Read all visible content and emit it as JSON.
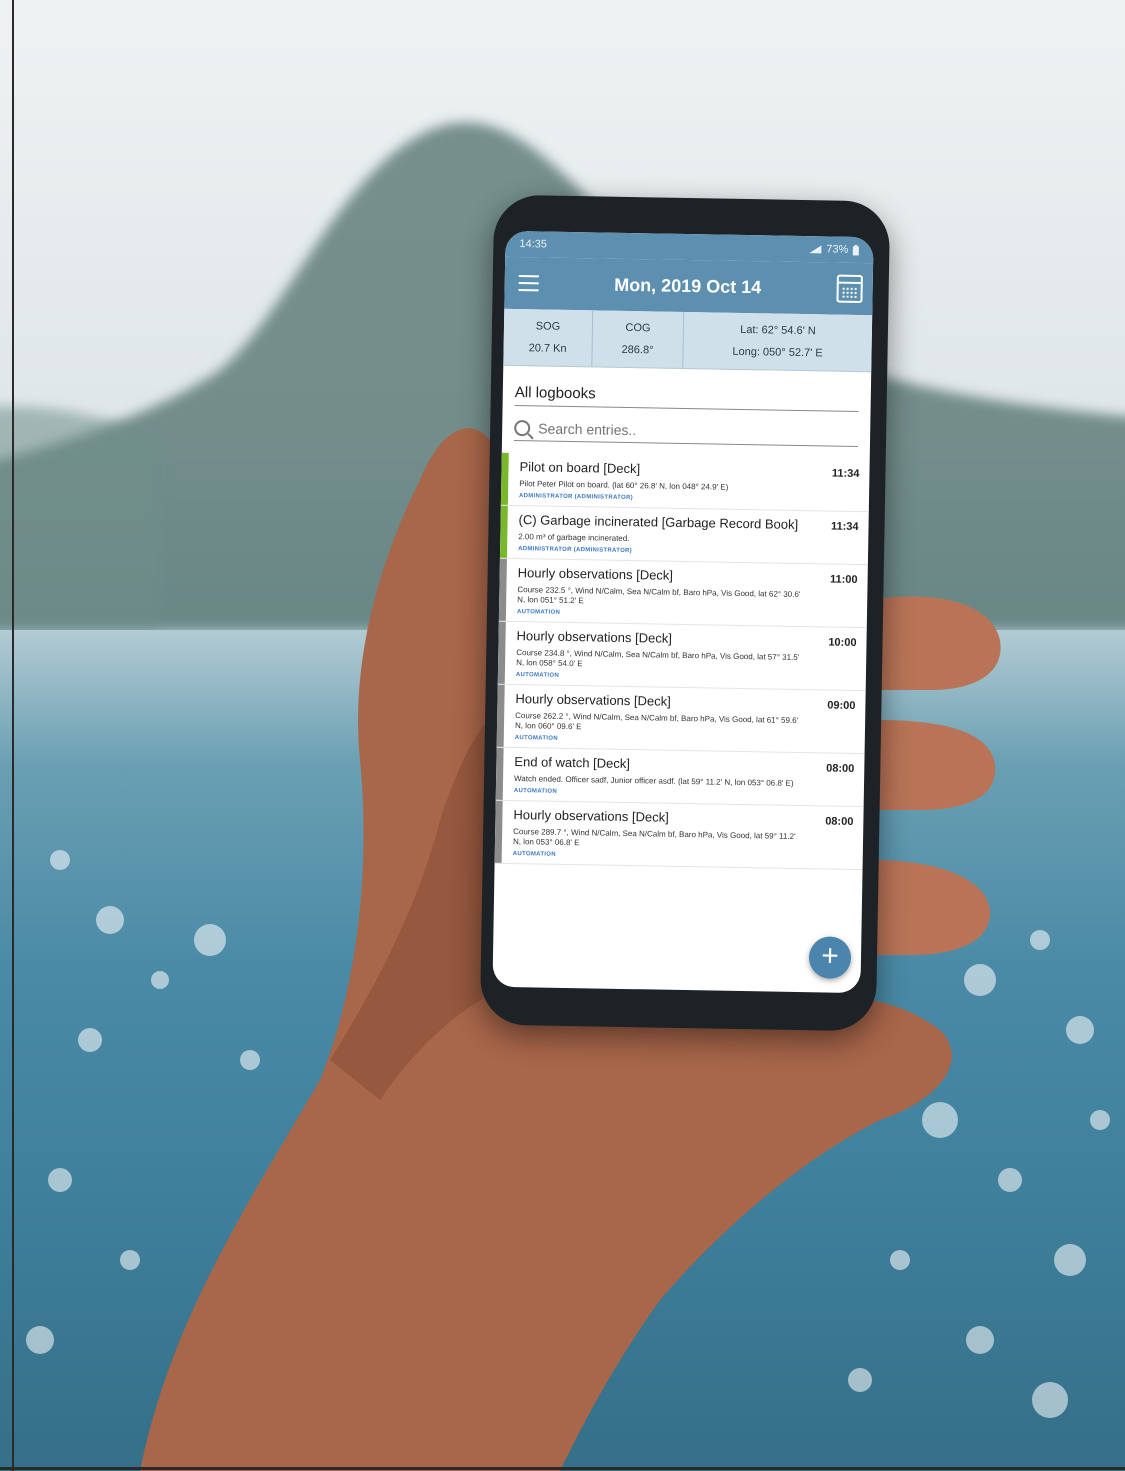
{
  "status_bar": {
    "time": "14:35",
    "battery": "73%"
  },
  "app_bar": {
    "title": "Mon, 2019 Oct 14"
  },
  "nav": {
    "sog_label": "SOG",
    "sog_value": "20.7 Kn",
    "cog_label": "COG",
    "cog_value": "286.8°",
    "lat": "Lat: 62° 54.6' N",
    "long": "Long: 050° 52.7' E"
  },
  "logbook_select": "All logbooks",
  "search": {
    "placeholder": "Search entries.."
  },
  "colors": {
    "accent": "#5d90b0",
    "green_bar": "#79b82a",
    "gray_bar": "#8c8c8c",
    "author": "#3a78c4"
  },
  "entries": [
    {
      "title": "Pilot on board [Deck]",
      "time": "11:34",
      "desc": "Pilot Peter Pilot on board. (lat 60° 26.8' N, lon 048° 24.9' E)",
      "author": "ADMINISTRATOR (ADMINISTRATOR)",
      "bar": "green"
    },
    {
      "title": "(C) Garbage incinerated [Garbage Record Book]",
      "time": "11:34",
      "desc": "2.00 m³ of garbage incinerated.",
      "author": "ADMINISTRATOR (ADMINISTRATOR)",
      "bar": "green"
    },
    {
      "title": "Hourly observations [Deck]",
      "time": "11:00",
      "desc": "Course 232.5 °, Wind N/Calm, Sea N/Calm bf, Baro hPa, Vis Good, lat 62° 30.6' N, lon 051° 51.2' E",
      "author": "AUTOMATION",
      "bar": "gray"
    },
    {
      "title": "Hourly observations [Deck]",
      "time": "10:00",
      "desc": "Course 234.8 °, Wind N/Calm, Sea N/Calm bf, Baro hPa, Vis Good, lat 57° 31.5' N, lon 058° 54.0' E",
      "author": "AUTOMATION",
      "bar": "gray"
    },
    {
      "title": "Hourly observations [Deck]",
      "time": "09:00",
      "desc": "Course 262.2 °, Wind N/Calm, Sea N/Calm bf, Baro hPa, Vis Good, lat 61° 59.6' N, lon 060° 09.6' E",
      "author": "AUTOMATION",
      "bar": "gray"
    },
    {
      "title": "End of watch [Deck]",
      "time": "08:00",
      "desc": "Watch ended. Officer sadf, Junior officer asdf. (lat 59° 11.2' N, lon 053° 06.8' E)",
      "author": "AUTOMATION",
      "bar": "gray"
    },
    {
      "title": "Hourly observations [Deck]",
      "time": "08:00",
      "desc": "Course 289.7 °, Wind N/Calm, Sea N/Calm bf, Baro hPa, Vis Good, lat 59° 11.2' N, lon 053° 06.8' E",
      "author": "AUTOMATION",
      "bar": "gray"
    }
  ],
  "fab_symbol": "+"
}
